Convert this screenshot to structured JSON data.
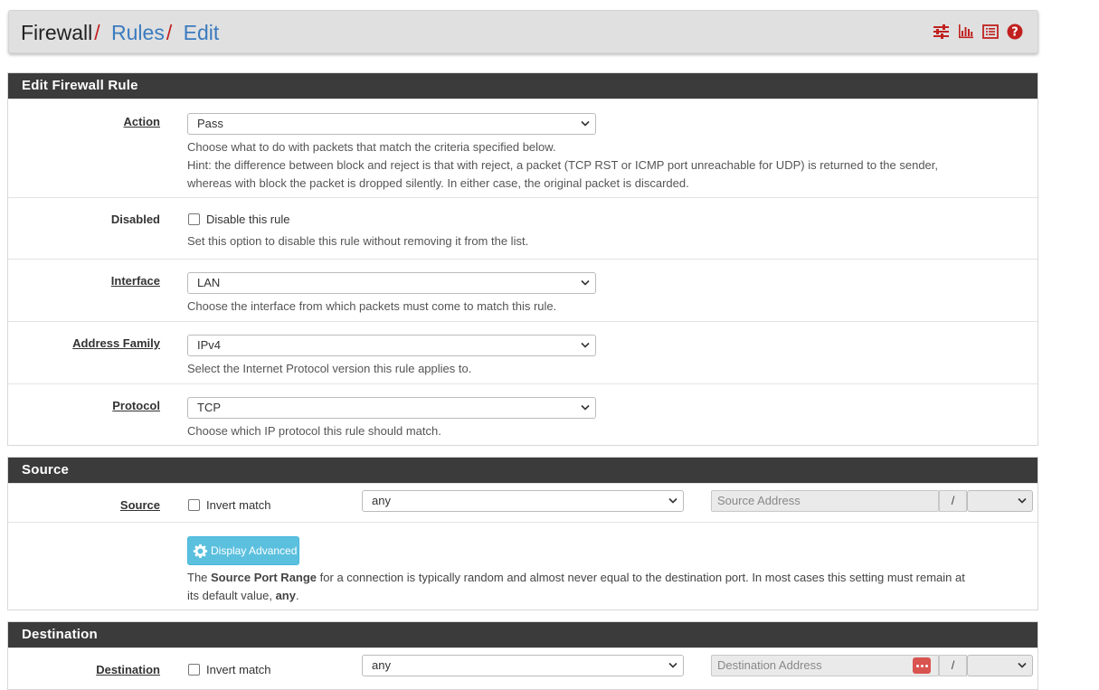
{
  "breadcrumb": {
    "items": [
      {
        "label": "Firewall",
        "link": false
      },
      {
        "label": "Rules",
        "link": true
      },
      {
        "label": "Edit",
        "link": true
      }
    ],
    "separator": "/"
  },
  "header_icons": [
    "sliders-icon",
    "bar-chart-icon",
    "list-icon",
    "help-icon"
  ],
  "colors": {
    "accent": "#c0211f",
    "link": "#3a7bbf",
    "panel_head": "#3b3b3b",
    "info_button": "#5bc0de"
  },
  "edit_panel": {
    "title": "Edit Firewall Rule",
    "action": {
      "label": "Action",
      "value": "Pass",
      "help1": "Choose what to do with packets that match the criteria specified below.",
      "help2": "Hint: the difference between block and reject is that with reject, a packet (TCP RST or ICMP port unreachable for UDP) is returned to the sender,",
      "help3": "whereas with block the packet is dropped silently. In either case, the original packet is discarded."
    },
    "disabled": {
      "label": "Disabled",
      "checkbox_label": "Disable this rule",
      "help": "Set this option to disable this rule without removing it from the list."
    },
    "interface": {
      "label": "Interface",
      "value": "LAN",
      "help": "Choose the interface from which packets must come to match this rule."
    },
    "address_family": {
      "label": "Address Family",
      "value": "IPv4",
      "help": "Select the Internet Protocol version this rule applies to."
    },
    "protocol": {
      "label": "Protocol",
      "value": "TCP",
      "help": "Choose which IP protocol this rule should match."
    }
  },
  "source_panel": {
    "title": "Source",
    "label": "Source",
    "invert_label": "Invert match",
    "type_value": "any",
    "address_placeholder": "Source Address",
    "slash": "/",
    "advanced_button": "Display Advanced",
    "help_pre": "The ",
    "help_bold": "Source Port Range",
    "help_mid": " for a connection is typically random and almost never equal to the destination port. In most cases this setting must remain at",
    "help_line2_pre": "its default value, ",
    "help_line2_bold": "any",
    "help_line2_post": "."
  },
  "destination_panel": {
    "title": "Destination",
    "label": "Destination",
    "invert_label": "Invert match",
    "type_value": "any",
    "address_placeholder": "Destination Address",
    "slash": "/"
  }
}
